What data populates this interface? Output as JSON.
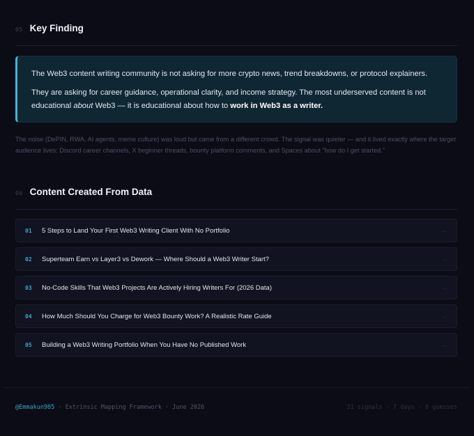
{
  "section1": {
    "number": "05",
    "title": "Key Finding"
  },
  "callout": {
    "p1": "The Web3 content writing community is not asking for more crypto news, trend breakdowns, or protocol explainers.",
    "p2_a": "They are asking for career guidance, operational clarity, and income strategy. The most underserved content is not educational ",
    "p2_em": "about",
    "p2_b": " Web3 — it is educational about how to ",
    "p2_strong": "work in Web3 as a writer."
  },
  "noise_text": "The noise (DePIN, RWA, AI agents, meme culture) was loud but came from a different crowd. The signal was quieter — and it lived exactly where the target audience lives: Discord career channels, X beginner threads, bounty platform comments, and Spaces about \"how do I get started.\"",
  "section2": {
    "number": "06",
    "title": "Content Created From Data"
  },
  "items": [
    {
      "num": "01",
      "title": "5 Steps to Land Your First Web3 Writing Client With No Portfolio",
      "arrow": "→"
    },
    {
      "num": "02",
      "title": "Superteam Earn vs Layer3 vs Dework — Where Should a Web3 Writer Start?",
      "arrow": "→"
    },
    {
      "num": "03",
      "title": "No-Code Skills That Web3 Projects Are Actively Hiring Writers For (2026 Data)",
      "arrow": "→"
    },
    {
      "num": "04",
      "title": "How Much Should You Charge for Web3 Bounty Work? A Realistic Rate Guide",
      "arrow": "→"
    },
    {
      "num": "05",
      "title": "Building a Web3 Writing Portfolio When You Have No Published Work",
      "arrow": "→"
    }
  ],
  "footer": {
    "handle": "@Emmakun985",
    "meta": " · Extrinsic Mapping Framework · June 2026",
    "stats": "31 signals · 7 days · 0 guesses"
  },
  "colors": {
    "accent": "#3fb7d6",
    "background": "#0b0c16",
    "callout_bg": "#0f2633"
  }
}
